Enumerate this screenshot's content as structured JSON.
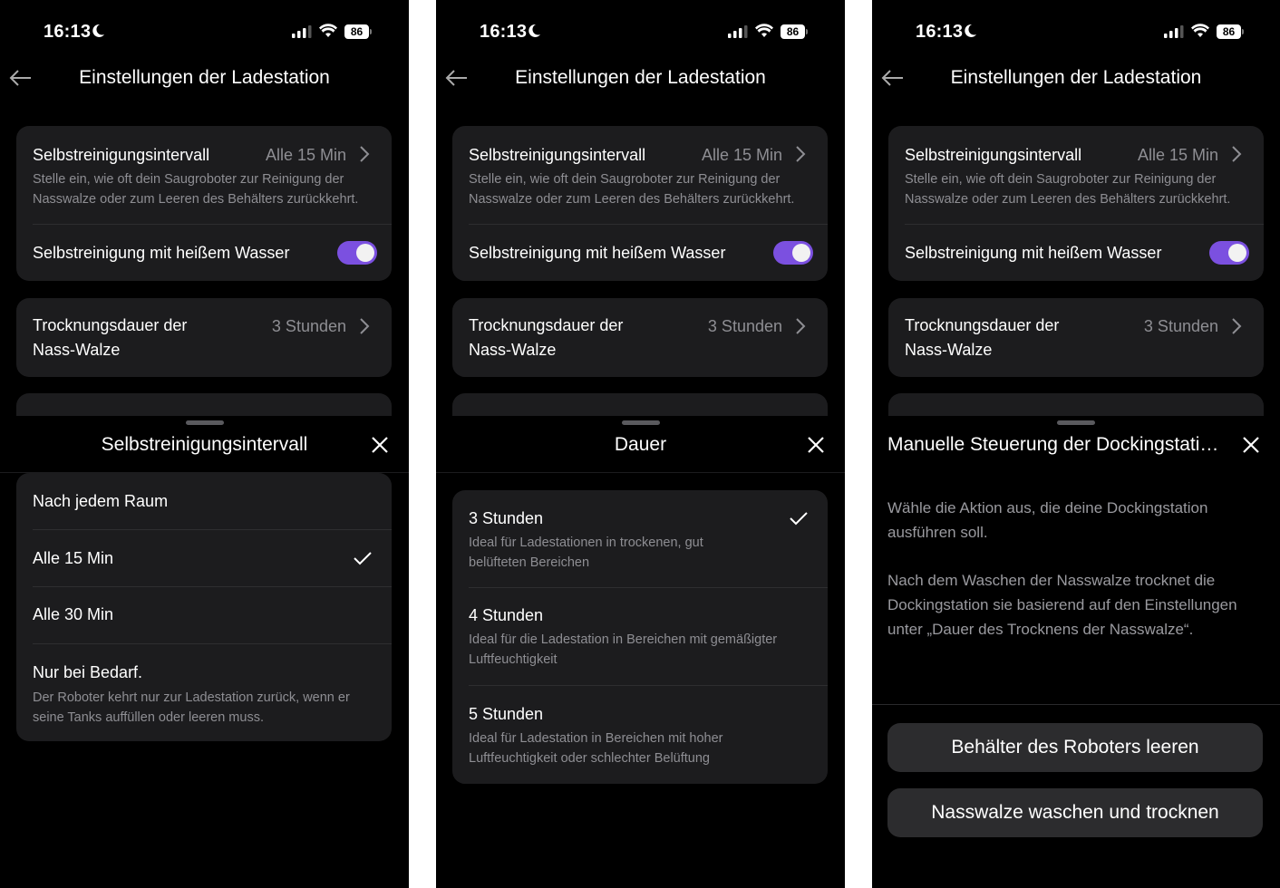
{
  "status_bar": {
    "time": "16:13",
    "battery": "86"
  },
  "nav": {
    "title": "Einstellungen der Ladestation"
  },
  "settings": {
    "interval_label": "Selbstreinigungsintervall",
    "interval_value": "Alle 15 Min",
    "interval_desc": "Stelle ein, wie oft dein Saugroboter zur Reinigung der Nasswalze oder zum Leeren des Behälters zurückkehrt.",
    "hot_water_label": "Selbstreinigung mit heißem Wasser",
    "hot_water_on": true,
    "drying_label_line1": "Trocknungsdauer der",
    "drying_label_line2": "Nass-Walze",
    "drying_value": "3 Stunden"
  },
  "sheet1": {
    "title": "Selbstreinigungsintervall",
    "options": [
      {
        "label": "Nach jedem Raum",
        "selected": false
      },
      {
        "label": "Alle 15 Min",
        "selected": true
      },
      {
        "label": "Alle 30 Min",
        "selected": false
      },
      {
        "label": "Nur bei Bedarf.",
        "desc": "Der Roboter kehrt nur zur Ladestation zurück, wenn er seine Tanks auffüllen oder leeren muss.",
        "selected": false
      }
    ]
  },
  "sheet2": {
    "title": "Dauer",
    "options": [
      {
        "label": "3 Stunden",
        "desc": "Ideal für Ladestationen in trockenen, gut belüfteten Bereichen",
        "selected": true
      },
      {
        "label": "4 Stunden",
        "desc": "Ideal für die Ladestation in Bereichen mit gemäßigter Luftfeuchtigkeit",
        "selected": false
      },
      {
        "label": "5 Stunden",
        "desc": "Ideal für Ladestation in Bereichen mit hoher Luftfeuchtigkeit oder schlechter Belüftung",
        "selected": false
      }
    ]
  },
  "sheet3": {
    "title": "Manuelle Steuerung der Dockingstati…",
    "para1": "Wähle die Aktion aus, die deine Dockingstation ausführen soll.",
    "para2": "Nach dem Waschen der Nasswalze trocknet die Dockingstation sie basierend auf den Einstellungen unter „Dauer des Trocknens der Nasswalze“.",
    "button1": "Behälter des Roboters leeren",
    "button2": "Nasswalze waschen und trocknen"
  },
  "colors": {
    "accent": "#7b50e0",
    "card": "#1c1c1e",
    "secondary_text": "#8e8e93"
  },
  "icons": [
    "moon-icon",
    "signal-icon",
    "wifi-icon",
    "battery-icon",
    "back-arrow-icon",
    "chevron-right-icon",
    "close-icon",
    "checkmark-icon"
  ]
}
